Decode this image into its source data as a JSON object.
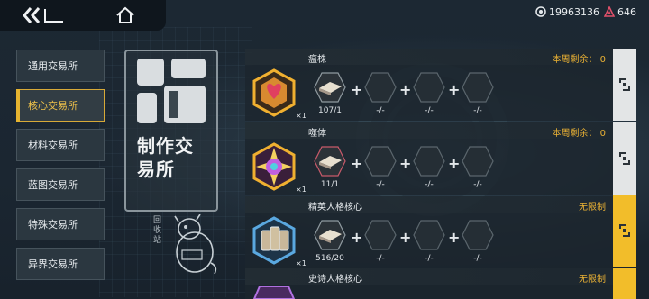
{
  "topbar": {
    "back_icon": "double-chevron-left-icon",
    "home_icon": "home-icon"
  },
  "currencies": [
    {
      "icon": "credit-coin-icon",
      "value": "19963136"
    },
    {
      "icon": "red-triangle-gem-icon",
      "value": "646",
      "color": "#e0506a"
    }
  ],
  "sidebar": {
    "items": [
      {
        "label": "通用交易所",
        "active": false
      },
      {
        "label": "核心交易所",
        "active": true
      },
      {
        "label": "材料交易所",
        "active": false
      },
      {
        "label": "蓝图交易所",
        "active": false
      },
      {
        "label": "特殊交易所",
        "active": false
      },
      {
        "label": "异界交易所",
        "active": false
      }
    ]
  },
  "emblem": {
    "title": "制作交易所",
    "recycle_label": "回收站"
  },
  "exchanges": [
    {
      "title": "瘟株",
      "limit": "本周剩余：  0",
      "product_count": "×1",
      "materials": [
        {
          "qty": "107/1",
          "filled": true
        },
        {
          "qty": "-/-",
          "filled": false
        },
        {
          "qty": "-/-",
          "filled": false
        },
        {
          "qty": "-/-",
          "filled": false
        }
      ],
      "action_style": "locked"
    },
    {
      "title": "噬体",
      "limit": "本周剩余：  0",
      "product_count": "×1",
      "materials": [
        {
          "qty": "11/1",
          "filled": true
        },
        {
          "qty": "-/-",
          "filled": false
        },
        {
          "qty": "-/-",
          "filled": false
        },
        {
          "qty": "-/-",
          "filled": false
        }
      ],
      "action_style": "locked"
    },
    {
      "title": "精英人格核心",
      "limit": "无限制",
      "product_count": "×1",
      "materials": [
        {
          "qty": "516/20",
          "filled": true
        },
        {
          "qty": "-/-",
          "filled": false
        },
        {
          "qty": "-/-",
          "filled": false
        },
        {
          "qty": "-/-",
          "filled": false
        }
      ],
      "action_style": "available"
    },
    {
      "title": "史诗人格核心",
      "limit": "无限制",
      "product_count": "",
      "materials": [],
      "action_style": "available"
    }
  ],
  "colors": {
    "accent_gold": "#f2bd2a",
    "limit_text": "#eab134",
    "active_border": "#d7a938"
  }
}
